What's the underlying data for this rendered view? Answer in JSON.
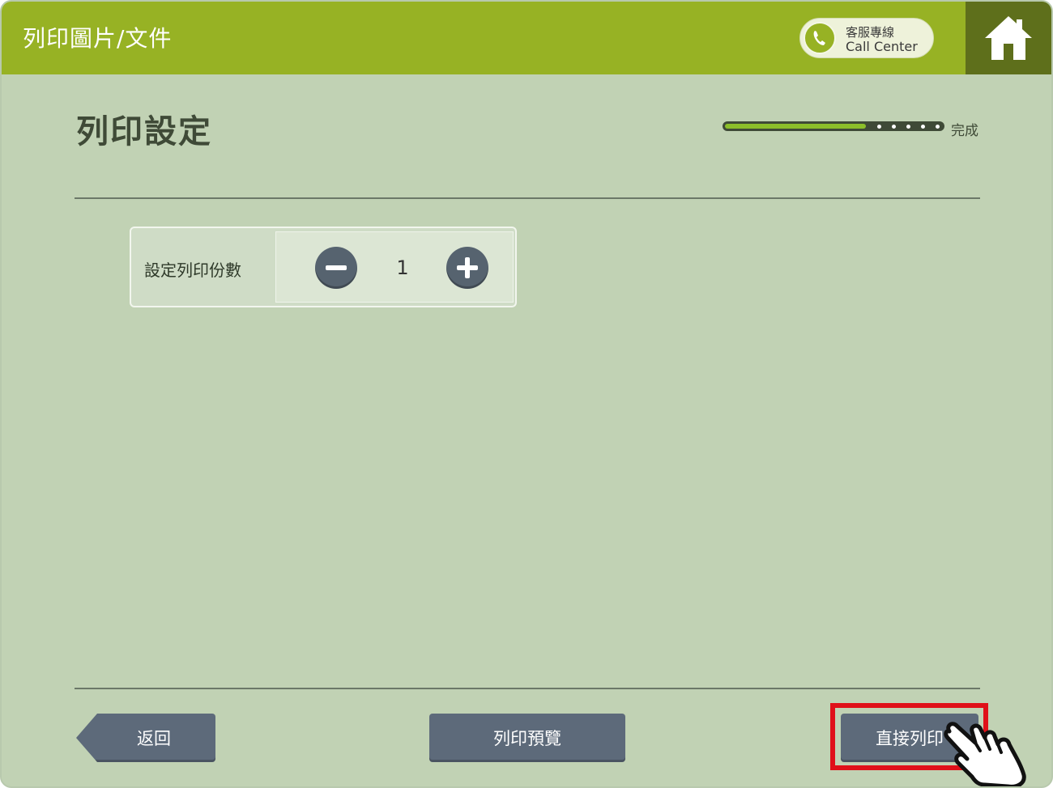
{
  "header": {
    "title": "列印圖片/文件",
    "call_center": {
      "line1": "客服專線",
      "line2": "Call Center"
    }
  },
  "page": {
    "heading": "列印設定"
  },
  "progress": {
    "fraction": 0.65,
    "end_label": "完成"
  },
  "copies": {
    "label": "設定列印份數",
    "value": "1"
  },
  "footer": {
    "back_label": "返回",
    "preview_label": "列印預覽",
    "direct_print_label": "直接列印"
  },
  "colors": {
    "header_bar": "#97b224",
    "home_tile": "#5e6f1b",
    "background": "#c1d2b4",
    "button": "#5d6a7a",
    "highlight": "#e01019"
  },
  "icons": [
    "phone-icon",
    "home-icon",
    "minus-icon",
    "plus-icon",
    "pointing-hand-icon"
  ]
}
